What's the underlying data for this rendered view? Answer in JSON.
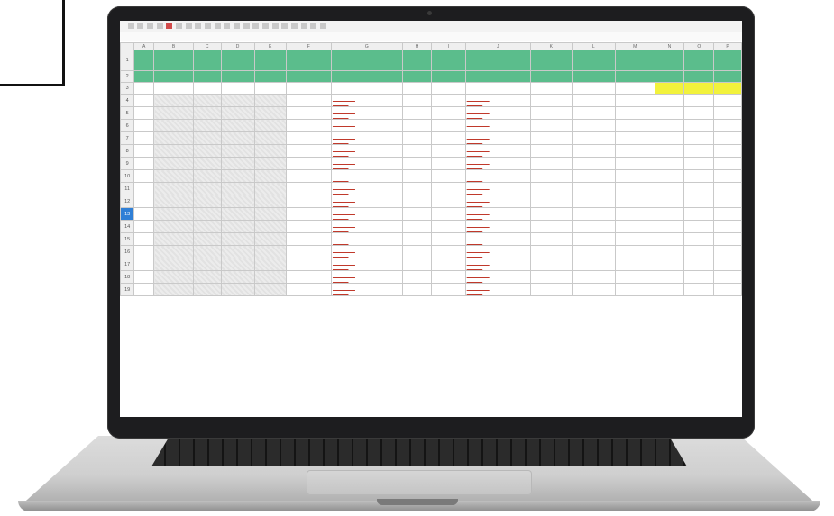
{
  "ribbon": {
    "font_name": "",
    "cell_ref": "",
    "formula": ""
  },
  "spreadsheet": {
    "column_letters": [
      "",
      "A",
      "B",
      "C",
      "D",
      "E",
      "F",
      "G",
      "H",
      "I",
      "J",
      "K",
      "L",
      "M",
      "N",
      "O",
      "P"
    ],
    "header_row_labels": [
      "",
      "",
      "",
      "",
      "",
      "",
      "",
      "",
      "",
      "",
      "",
      "",
      "",
      "",
      "",
      "",
      ""
    ],
    "selected_row": 13,
    "row_numbers": [
      1,
      2,
      3,
      4,
      5,
      6,
      7,
      8,
      9,
      10,
      11,
      12,
      13,
      14,
      15,
      16,
      17,
      18,
      19
    ],
    "colors": {
      "header_green": "#5bbd8c",
      "highlight_yellow": "#f2f23c",
      "selection_blue": "#2f7fd6"
    }
  }
}
